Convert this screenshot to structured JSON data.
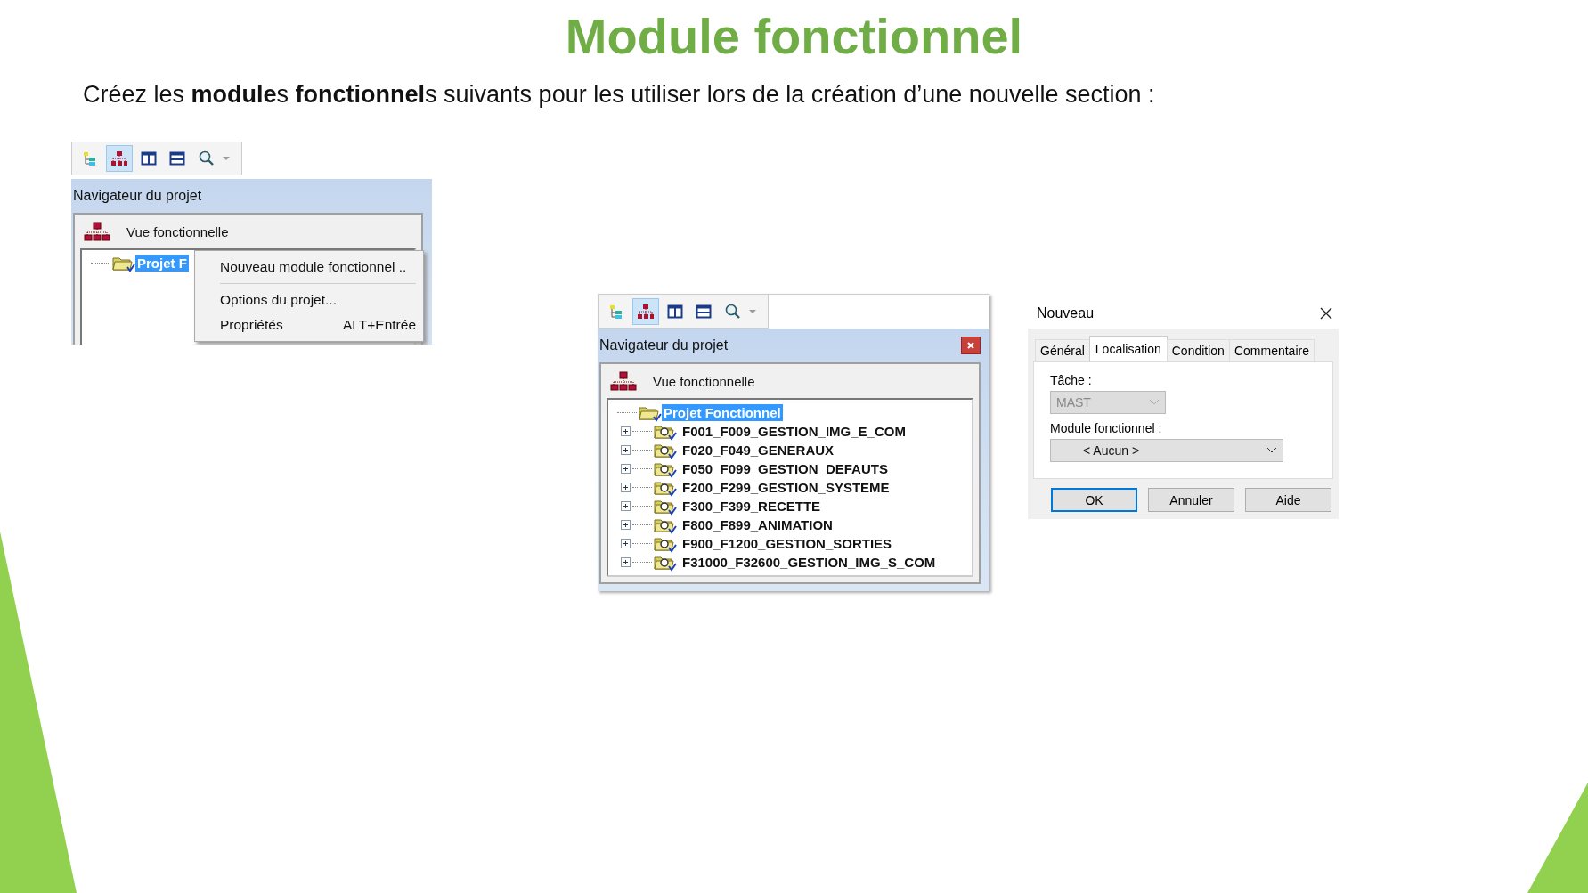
{
  "slide": {
    "title": "Module fonctionnel",
    "instruction": "Créez les **module**s **fonctionnel**s suivants pour les utiliser lors de la création d’une nouvelle section :"
  },
  "left_screenshot": {
    "toolbar": [
      {
        "kind": "tree",
        "selected": false
      },
      {
        "kind": "hierarchy",
        "selected": true
      },
      {
        "kind": "columns",
        "selected": false
      },
      {
        "kind": "rows",
        "selected": false
      },
      {
        "kind": "zoom",
        "selected": false
      }
    ],
    "navigator": {
      "title": "Navigateur du projet",
      "view_label": "Vue fonctionnelle",
      "tree": {
        "label": "Projet F",
        "selected": true
      }
    },
    "context_menu": [
      {
        "kind": "item",
        "label": "Nouveau module fonctionnel .."
      },
      {
        "kind": "separator"
      },
      {
        "kind": "item",
        "label": "Options du projet..."
      },
      {
        "kind": "item",
        "label": "Propriétés",
        "shortcut": "ALT+Entrée"
      }
    ]
  },
  "middle_screenshot": {
    "toolbar": [
      {
        "kind": "tree",
        "selected": false
      },
      {
        "kind": "hierarchy",
        "selected": true
      },
      {
        "kind": "columns",
        "selected": false
      },
      {
        "kind": "rows",
        "selected": false
      },
      {
        "kind": "zoom",
        "selected": false
      }
    ],
    "navigator": {
      "title": "Navigateur du projet",
      "view_label": "Vue fonctionnelle",
      "tree": {
        "label": "Projet Fonctionnel",
        "selected": true,
        "children": [
          {
            "label": "F001_F009_GESTION_IMG_E_COM",
            "expanded": false
          },
          {
            "label": "F020_F049_GENERAUX",
            "expanded": false
          },
          {
            "label": "F050_F099_GESTION_DEFAUTS",
            "expanded": false
          },
          {
            "label": "F200_F299_GESTION_SYSTEME",
            "expanded": false
          },
          {
            "label": "F300_F399_RECETTE",
            "expanded": false
          },
          {
            "label": "F800_F899_ANIMATION",
            "expanded": false
          },
          {
            "label": "F900_F1200_GESTION_SORTIES",
            "expanded": false
          },
          {
            "label": "F31000_F32600_GESTION_IMG_S_COM",
            "expanded": false
          }
        ]
      }
    }
  },
  "dialog": {
    "title": "Nouveau",
    "tabs": [
      {
        "label": "Général",
        "selected": false
      },
      {
        "label": "Localisation",
        "selected": true
      },
      {
        "label": "Condition",
        "selected": false
      },
      {
        "label": "Commentaire",
        "selected": false
      }
    ],
    "fields": [
      {
        "label": "Tâche :",
        "value": "MAST",
        "disabled": true
      },
      {
        "label": "Module fonctionnel :",
        "value": "< Aucun >",
        "disabled": false
      }
    ],
    "buttons": [
      {
        "label": "OK",
        "default": true
      },
      {
        "label": "Annuler",
        "default": false
      },
      {
        "label": "Aide",
        "default": false
      }
    ]
  }
}
